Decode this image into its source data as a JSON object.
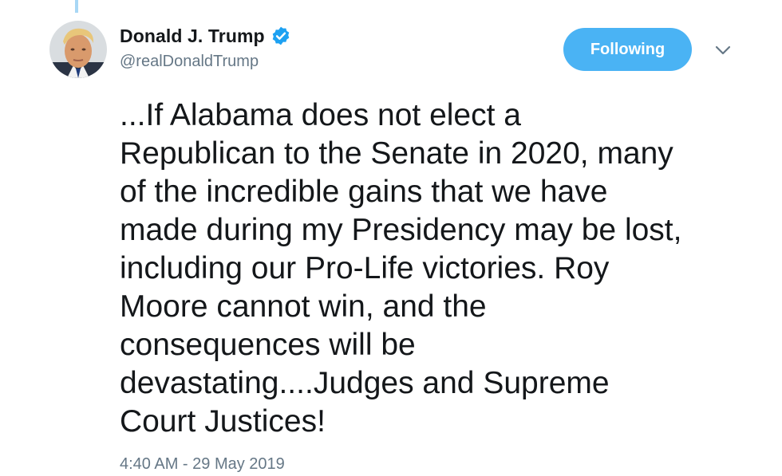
{
  "tweet": {
    "author": {
      "display_name": "Donald J. Trump",
      "handle": "@realDonaldTrump",
      "verified_icon": "verified-badge-icon",
      "avatar_icon": "profile-photo"
    },
    "follow_button_label": "Following",
    "caret_icon": "chevron-down-icon",
    "text_lines": [
      "...If Alabama does not elect a",
      "Republican to the Senate in 2020, many",
      "of the incredible gains that we have",
      "made during my Presidency may be lost,",
      "including our Pro-Life victories. Roy",
      "Moore cannot win, and the",
      "consequences will be",
      "devastating....Judges and Supreme",
      "Court Justices!"
    ],
    "timestamp": "4:40 AM - 29 May 2019"
  },
  "colors": {
    "accent": "#4ab3f4",
    "text": "#14171a",
    "secondary_text": "#657786",
    "verified": "#1da1f2",
    "thread_line": "#a8d7f5"
  }
}
